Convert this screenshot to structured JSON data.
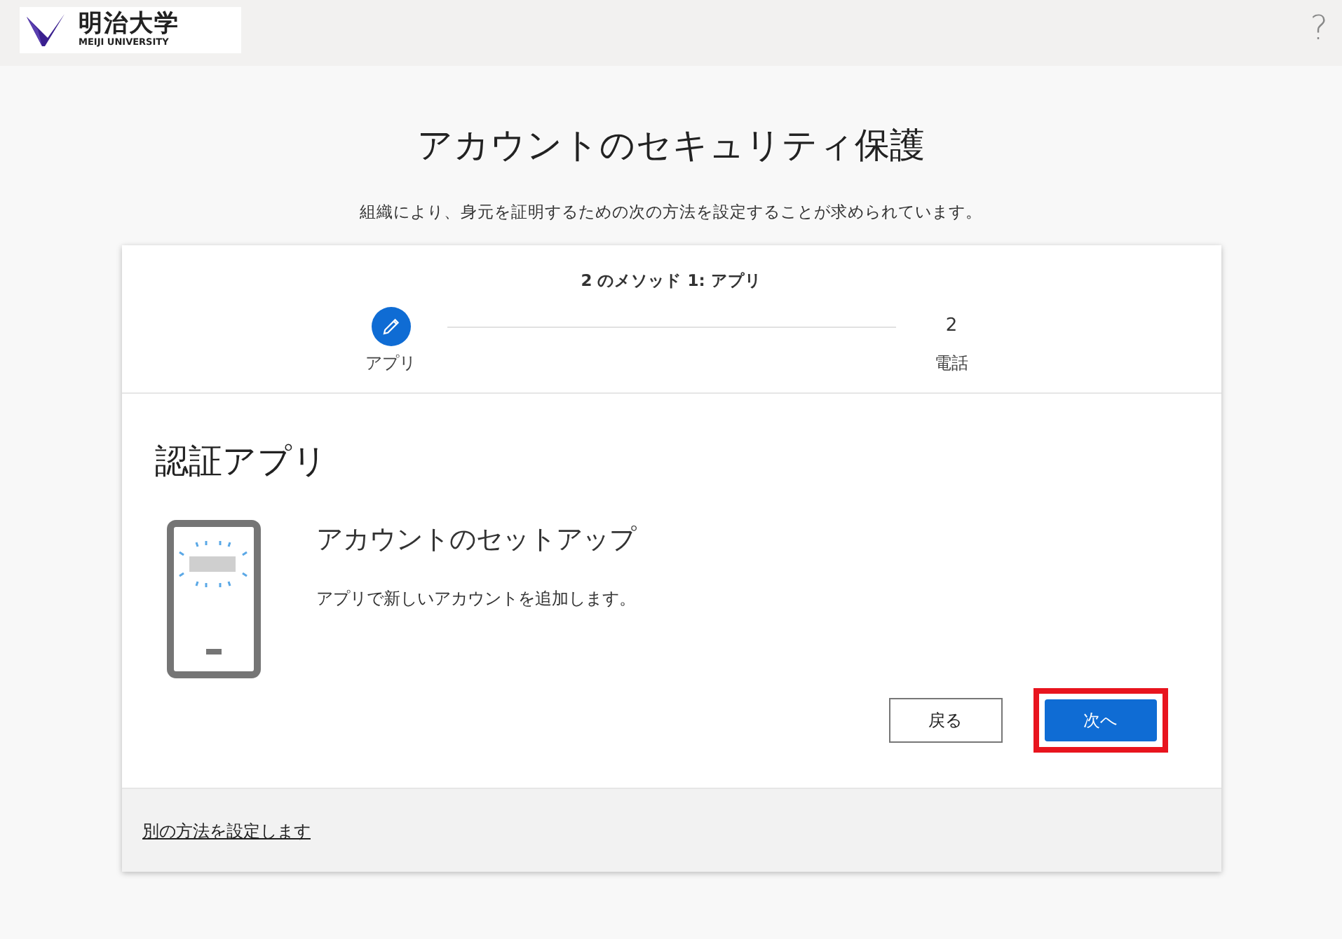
{
  "header": {
    "logo": {
      "name": "明治大学",
      "subtitle": "MEIJI UNIVERSITY"
    },
    "help": "?"
  },
  "title": "アカウントのセキュリティ保護",
  "subtitle": "組織により、身元を証明するための次の方法を設定することが求められています。",
  "card": {
    "progress": "2 のメソッド 1: アプリ",
    "steps": [
      {
        "kind": "current",
        "label": "アプリ"
      },
      {
        "kind": "pending",
        "number": "2",
        "label": "電話"
      }
    ],
    "heading": "認証アプリ",
    "setup_title": "アカウントのセットアップ",
    "setup_text": "アプリで新しいアカウントを追加します。",
    "buttons": [
      {
        "kind": "secondary",
        "label": "戻る",
        "highlighted": false
      },
      {
        "kind": "primary",
        "label": "次へ",
        "highlighted": true
      }
    ],
    "footer_link": "別の方法を設定します"
  }
}
